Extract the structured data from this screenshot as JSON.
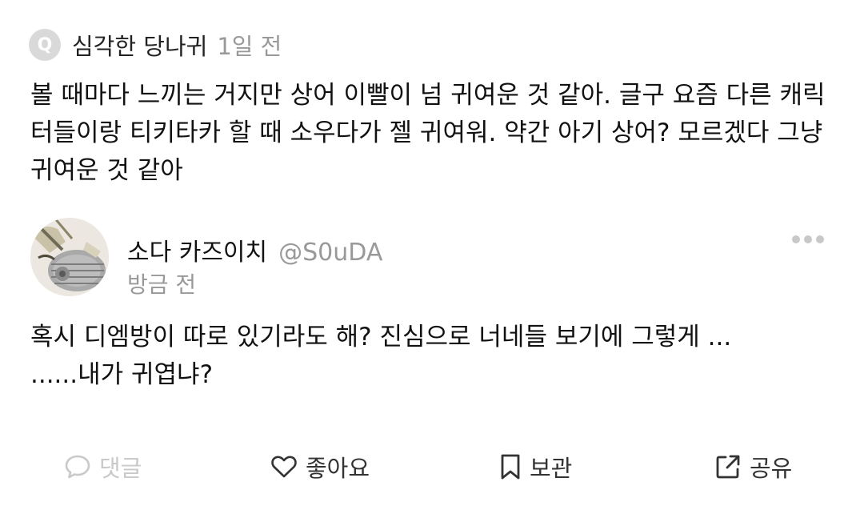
{
  "question": {
    "badge": "Q",
    "asker": "심각한 당나귀",
    "time": "1일 전",
    "text": "볼 때마다 느끼는 거지만 상어 이빨이 넘 귀여운 것 같아. 글구 요즘 다른 캐릭터들이랑 티키타카 할 때 소우다가 젤 귀여워. 약간 아기 상어? 모르겠다 그냥 귀여운 것 같아"
  },
  "answer": {
    "name": "소다 카즈이치",
    "handle": "@S0uDA",
    "time": "방금 전",
    "lines": [
      "혹시 디엠방이 따로 있기라도 해? 진심으로 너네들 보기에 그렇게 ...",
      "......내가 귀엽냐?"
    ]
  },
  "actions": {
    "comment": "댓글",
    "like": "좋아요",
    "save": "보관",
    "share": "공유"
  },
  "icons": {
    "q_badge": "q-badge-icon",
    "more": "more-dots-icon",
    "comment": "speech-bubble-icon",
    "like": "heart-icon",
    "save": "bookmark-icon",
    "share": "share-arrow-icon"
  },
  "colors": {
    "primary_text": "#111111",
    "secondary_text": "#999999",
    "disabled_text": "#c9c9c9",
    "badge_bg": "#d9d9d9",
    "background": "#ffffff"
  }
}
